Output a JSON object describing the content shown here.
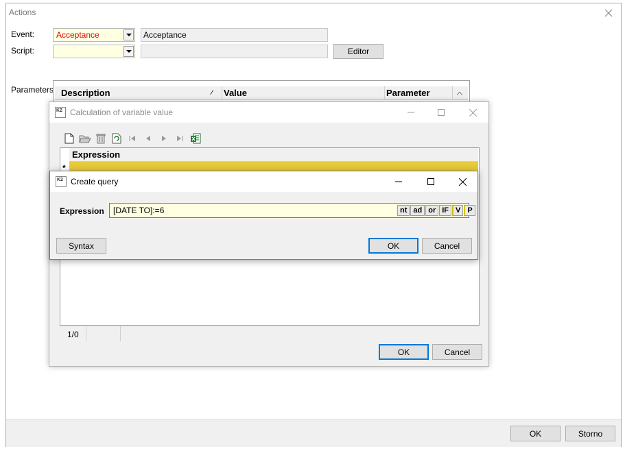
{
  "actions": {
    "title": "Actions",
    "event_label": "Event:",
    "event_value": "Acceptance",
    "event_description": "Acceptance",
    "script_label": "Script:",
    "script_value": "",
    "script_description": "",
    "editor_button": "Editor",
    "parameters_label": "Parameters:",
    "columns": [
      "Description",
      "Value",
      "Parameter"
    ],
    "ok_button": "OK",
    "storno_button": "Storno",
    "event_text_color": "#e00000"
  },
  "calc": {
    "title": "Calculation of variable value",
    "icon_text": "K2",
    "toolbar_icons": [
      "new-icon",
      "open-icon",
      "delete-icon",
      "refresh-icon",
      "first-icon",
      "prev-icon",
      "next-icon",
      "last-icon",
      "excel-icon"
    ],
    "grid_header": "Expression",
    "row_indicator": "*",
    "status_position": "1/0",
    "ok_button": "OK",
    "cancel_button": "Cancel",
    "selected_row_color": "#e8cb3b"
  },
  "query": {
    "title": "Create query",
    "icon_text": "K2",
    "expression_label": "Expression",
    "expression_value": "[DATE TO]:=6",
    "operators": [
      "nt",
      "ad",
      "or",
      "IF",
      "V",
      "P"
    ],
    "syntax_button": "Syntax",
    "ok_button": "OK",
    "cancel_button": "Cancel",
    "accent": "#0078d7"
  }
}
